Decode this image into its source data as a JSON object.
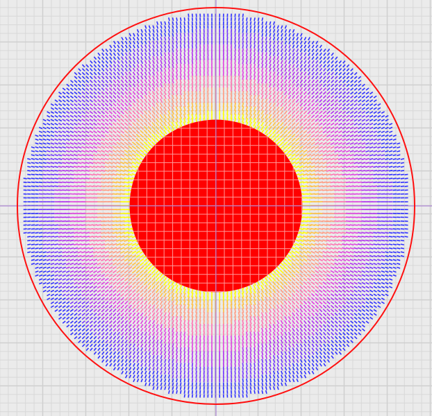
{
  "colors": {
    "background": "#ebebeb",
    "grid_minor": "#d8d8d8",
    "grid_major": "#cfcfcf",
    "axis": "#a070d0",
    "boundary": "#ff1010",
    "core_fill": "#ff0000",
    "core_grid": "#ff9a9a",
    "field_ramp": [
      "#ffff00",
      "#ffc040",
      "#ff9a80",
      "#ff70b0",
      "#e040e0",
      "#b030f0",
      "#7030ff",
      "#3030ff"
    ]
  },
  "field": {
    "type": "radial-vector-field",
    "inner_radius_ratio": 0.435,
    "color_bins": 8
  }
}
